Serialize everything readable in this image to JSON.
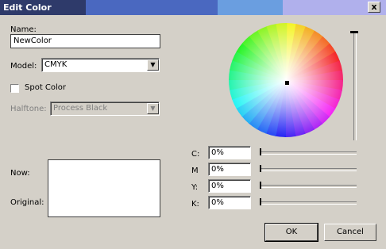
{
  "window": {
    "title": "Edit Color",
    "close_glyph": "x",
    "title_colors": [
      "#2e3a6a",
      "#4a68c0",
      "#6a9ee0",
      "#b0b0ec"
    ]
  },
  "name": {
    "label": "Name:",
    "value": "NewColor"
  },
  "model": {
    "label": "Model:",
    "value": "CMYK",
    "icon": "dropdown-arrow"
  },
  "spot_color": {
    "label": "Spot Color",
    "checked": false
  },
  "halftone": {
    "label": "Halftone:",
    "value": "Process Black",
    "icon": "dropdown-arrow"
  },
  "preview": {
    "now_label": "Now:",
    "original_label": "Original:"
  },
  "channels": [
    {
      "label": "C:",
      "value": "0%",
      "level": 0
    },
    {
      "label": "M",
      "value": "0%",
      "level": 0
    },
    {
      "label": "Y:",
      "value": "0%",
      "level": 0
    },
    {
      "label": "K:",
      "value": "0%",
      "level": 0
    }
  ],
  "buttons": {
    "ok": "OK",
    "cancel": "Cancel"
  }
}
